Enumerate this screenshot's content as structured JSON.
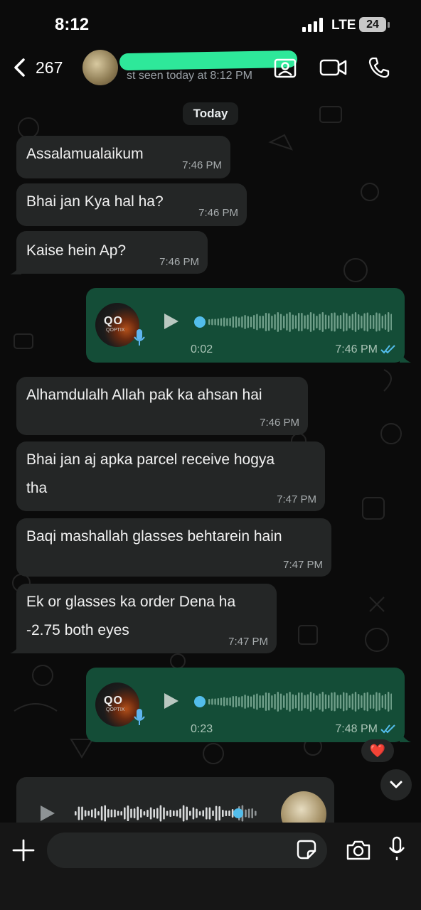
{
  "status_bar": {
    "time": "8:12",
    "network": "LTE",
    "battery": "24"
  },
  "header": {
    "back_count": "267",
    "last_seen": "st seen today at 8:12 PM"
  },
  "day_separator": "Today",
  "messages": [
    {
      "type": "text",
      "direction": "incoming",
      "lines": [
        "Assalamualaikum"
      ],
      "time": "7:46 PM"
    },
    {
      "type": "text",
      "direction": "incoming",
      "lines": [
        "Bhai jan Kya hal ha?"
      ],
      "time": "7:46 PM"
    },
    {
      "type": "text",
      "direction": "incoming",
      "lines": [
        "Kaise hein Ap?"
      ],
      "time": "7:46 PM"
    },
    {
      "type": "voice",
      "direction": "outgoing",
      "duration": "0:02",
      "time": "7:46 PM",
      "avatar_logo": "QO",
      "avatar_sub": "QOPTIX",
      "progress": 0.0
    },
    {
      "type": "text",
      "direction": "incoming",
      "lines": [
        "Alhamdulalh Allah pak ka ahsan hai"
      ],
      "time": "7:46 PM"
    },
    {
      "type": "text",
      "direction": "incoming",
      "lines": [
        "Bhai jan aj apka parcel receive hogya",
        "tha"
      ],
      "time": "7:47 PM"
    },
    {
      "type": "text",
      "direction": "incoming",
      "lines": [
        "Baqi mashallah glasses behtarein hain"
      ],
      "time": "7:47 PM"
    },
    {
      "type": "text",
      "direction": "incoming",
      "lines": [
        "Ek or glasses ka order Dena ha",
        "-2.75 both eyes"
      ],
      "time": "7:47 PM"
    },
    {
      "type": "voice",
      "direction": "outgoing",
      "duration": "0:23",
      "time": "7:48 PM",
      "avatar_logo": "QO",
      "avatar_sub": "QOPTIX",
      "progress": 0.0,
      "reaction": "❤️"
    }
  ],
  "icons": [
    "chevron-left-icon",
    "contact-card-icon",
    "video-call-icon",
    "phone-icon",
    "play-icon",
    "mic-icon",
    "double-check-icon",
    "chevron-down-icon",
    "plus-icon",
    "sticker-icon",
    "camera-icon"
  ],
  "colors": {
    "background": "#0b0b0b",
    "incoming_bubble": "#242626",
    "outgoing_bubble": "#144d37",
    "tick": "#53bdeb",
    "wave_played": "#53bdeb"
  }
}
